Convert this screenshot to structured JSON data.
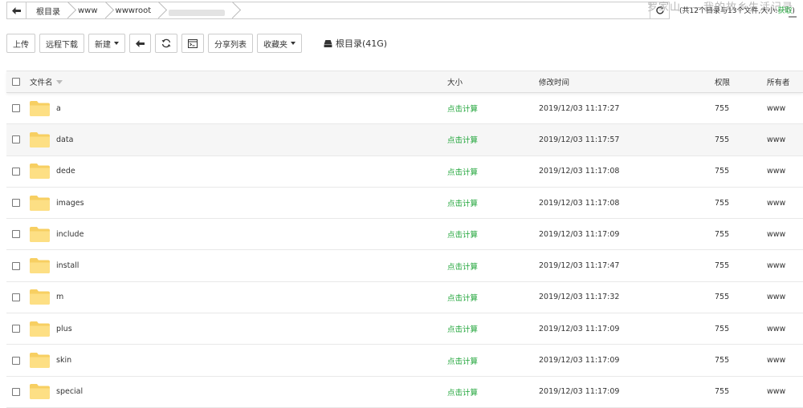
{
  "pathbar": {
    "crumbs": [
      "根目录",
      "www",
      "wwwroot"
    ]
  },
  "summary": {
    "text": "(共12个目录与13个文件,大小:",
    "link": "获取",
    "close": ")"
  },
  "watermark": "罗家山——我的故乡生活记录",
  "toolbar": {
    "upload": "上传",
    "remote_download": "远程下载",
    "new": "新建",
    "share_list": "分享列表",
    "favorites": "收藏夹",
    "disk_label": "根目录(41G)"
  },
  "table": {
    "headers": {
      "name": "文件名",
      "size": "大小",
      "modified": "修改时间",
      "permission": "权限",
      "owner": "所有者"
    },
    "rows": [
      {
        "name": "a",
        "size": "点击计算",
        "modified": "2019/12/03 11:17:27",
        "permission": "755",
        "owner": "www"
      },
      {
        "name": "data",
        "size": "点击计算",
        "modified": "2019/12/03 11:17:57",
        "permission": "755",
        "owner": "www"
      },
      {
        "name": "dede",
        "size": "点击计算",
        "modified": "2019/12/03 11:17:08",
        "permission": "755",
        "owner": "www"
      },
      {
        "name": "images",
        "size": "点击计算",
        "modified": "2019/12/03 11:17:08",
        "permission": "755",
        "owner": "www"
      },
      {
        "name": "include",
        "size": "点击计算",
        "modified": "2019/12/03 11:17:09",
        "permission": "755",
        "owner": "www"
      },
      {
        "name": "install",
        "size": "点击计算",
        "modified": "2019/12/03 11:17:47",
        "permission": "755",
        "owner": "www"
      },
      {
        "name": "m",
        "size": "点击计算",
        "modified": "2019/12/03 11:17:32",
        "permission": "755",
        "owner": "www"
      },
      {
        "name": "plus",
        "size": "点击计算",
        "modified": "2019/12/03 11:17:09",
        "permission": "755",
        "owner": "www"
      },
      {
        "name": "skin",
        "size": "点击计算",
        "modified": "2019/12/03 11:17:09",
        "permission": "755",
        "owner": "www"
      },
      {
        "name": "special",
        "size": "点击计算",
        "modified": "2019/12/03 11:17:09",
        "permission": "755",
        "owner": "www"
      }
    ]
  },
  "colors": {
    "accent_green": "#20a53a",
    "folder_fill": "#fddf84",
    "folder_tab": "#f7cf62",
    "row_alt": "#f6f6f6"
  }
}
